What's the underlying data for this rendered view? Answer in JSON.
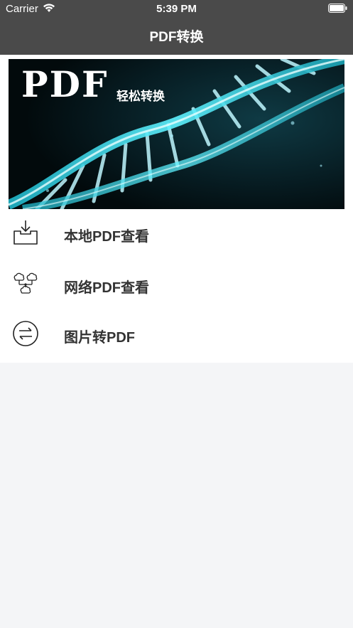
{
  "status_bar": {
    "carrier": "Carrier",
    "time": "5:39 PM"
  },
  "nav": {
    "title": "PDF转换"
  },
  "banner": {
    "logo_text": "PDF",
    "subtitle": "轻松转换"
  },
  "menu": {
    "items": [
      {
        "label": "本地PDF查看",
        "icon": "inbox-download-icon"
      },
      {
        "label": "网络PDF查看",
        "icon": "cloud-network-icon"
      },
      {
        "label": "图片转PDF",
        "icon": "convert-arrows-icon"
      }
    ]
  },
  "colors": {
    "nav_background": "#4a4a4a",
    "page_background": "#f4f5f7",
    "accent_cyan": "#3fe0f0"
  }
}
